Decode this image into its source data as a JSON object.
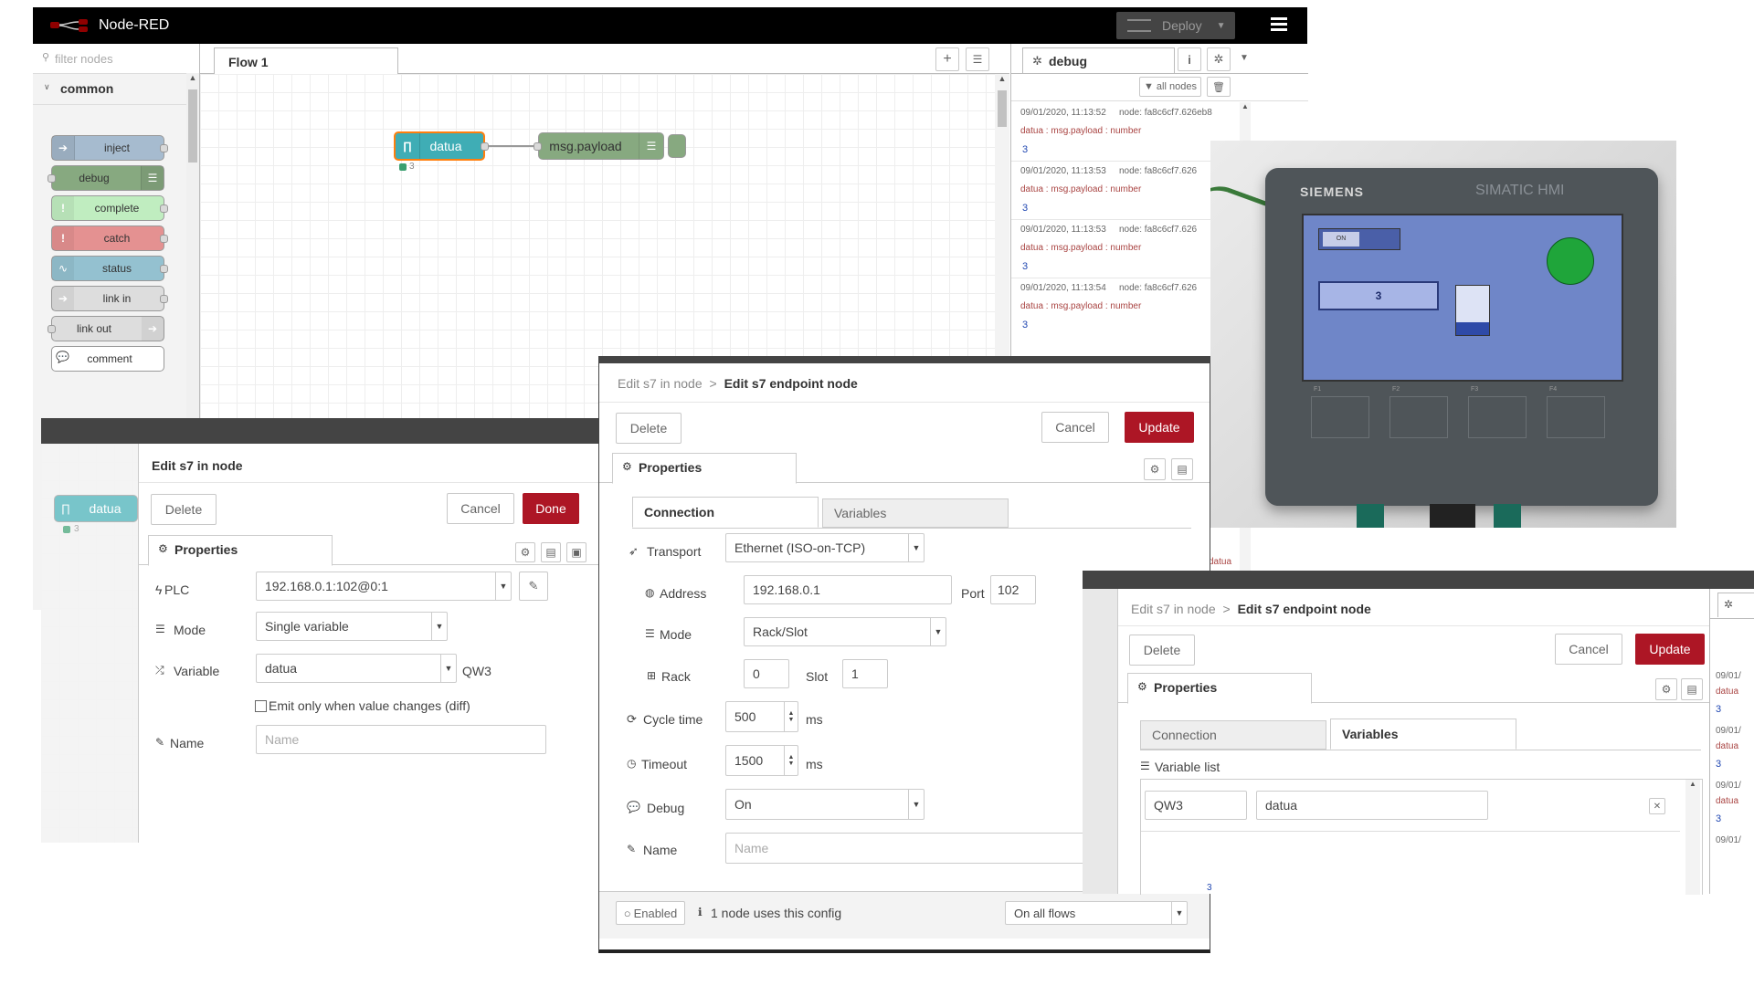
{
  "app": {
    "title": "Node-RED",
    "deploy_label": "Deploy"
  },
  "palette": {
    "filter_placeholder": "filter nodes",
    "category": "common",
    "nodes": [
      "inject",
      "debug",
      "complete",
      "catch",
      "status",
      "link in",
      "link out",
      "comment"
    ]
  },
  "workspace": {
    "tab": "Flow 1",
    "node_s7": "datua",
    "node_s7_status": "3",
    "node_debug": "msg.payload"
  },
  "debug_panel": {
    "title": "debug",
    "filter_label": "all nodes",
    "messages": [
      {
        "time": "09/01/2020, 11:13:52",
        "node": "node: fa8c6cf7.626eb8",
        "meta": "datua : msg.payload : number",
        "value": "3"
      },
      {
        "time": "09/01/2020, 11:13:53",
        "node": "node: fa8c6cf7.626",
        "meta": "datua : msg.payload : number",
        "value": "3"
      },
      {
        "time": "09/01/2020, 11:13:53",
        "node": "node: fa8c6cf7.626",
        "meta": "datua : msg.payload : number",
        "value": "3"
      },
      {
        "time": "09/01/2020, 11:13:54",
        "node": "node: fa8c6cf7.626",
        "meta": "datua : msg.payload : number",
        "value": "3"
      }
    ],
    "partial_meta": "datua",
    "partial_value": "3"
  },
  "edit_in_node": {
    "title": "Edit s7 in node",
    "delete": "Delete",
    "cancel": "Cancel",
    "done": "Done",
    "properties_tab": "Properties",
    "plc_label": "PLC",
    "plc_value": "192.168.0.1:102@0:1",
    "mode_label": "Mode",
    "mode_value": "Single variable",
    "variable_label": "Variable",
    "variable_value": "datua",
    "variable_address": "QW3",
    "diff_label": "Emit only when value changes (diff)",
    "name_label": "Name",
    "name_placeholder": "Name",
    "bg_node": "datua",
    "bg_status": "3"
  },
  "edit_endpoint_connection": {
    "breadcrumb_parent": "Edit s7 in node",
    "breadcrumb_sep": ">",
    "title": "Edit s7 endpoint node",
    "delete": "Delete",
    "cancel": "Cancel",
    "update": "Update",
    "properties_tab": "Properties",
    "tab_connection": "Connection",
    "tab_variables": "Variables",
    "transport_label": "Transport",
    "transport_value": "Ethernet (ISO-on-TCP)",
    "address_label": "Address",
    "address_value": "192.168.0.1",
    "port_label": "Port",
    "port_value": "102",
    "mode_label": "Mode",
    "mode_value": "Rack/Slot",
    "rack_label": "Rack",
    "rack_value": "0",
    "slot_label": "Slot",
    "slot_value": "1",
    "cycle_label": "Cycle time",
    "cycle_value": "500",
    "cycle_unit": "ms",
    "timeout_label": "Timeout",
    "timeout_value": "1500",
    "timeout_unit": "ms",
    "debug_label": "Debug",
    "debug_value": "On",
    "name_label": "Name",
    "name_placeholder": "Name",
    "enabled_label": "Enabled",
    "usage_text": "1 node uses this config",
    "scope_value": "On all flows"
  },
  "edit_endpoint_variables": {
    "breadcrumb_parent": "Edit s7 in node",
    "breadcrumb_sep": ">",
    "title": "Edit s7 endpoint node",
    "delete": "Delete",
    "cancel": "Cancel",
    "update": "Update",
    "properties_tab": "Properties",
    "tab_connection": "Connection",
    "tab_variables": "Variables",
    "variable_list_label": "Variable list",
    "var_address": "QW3",
    "var_name": "datua",
    "side_messages": [
      {
        "time": "09/01/",
        "meta": "datua",
        "value": "3"
      },
      {
        "time": "09/01/",
        "meta": "datua",
        "value": "3"
      },
      {
        "time": "09/01/",
        "meta": "datua",
        "value": "3"
      },
      {
        "time": "09/01/"
      }
    ],
    "side_partial_value": "3"
  },
  "hmi_photo": {
    "brand": "SIEMENS",
    "model": "SIMATIC HMI",
    "toggle_label": "ON",
    "display_value": "3",
    "function_keys": [
      "F1",
      "F2",
      "F3",
      "F4"
    ]
  },
  "colors": {
    "header": "#000000",
    "accent_red": "#ad1625",
    "s7_node": "#3fadb5",
    "debug_node": "#87a980",
    "inject_node": "#a6bbcf",
    "complete_node": "#c0edc0",
    "catch_node": "#e49191",
    "hmi_screen": "#6f86c8"
  }
}
